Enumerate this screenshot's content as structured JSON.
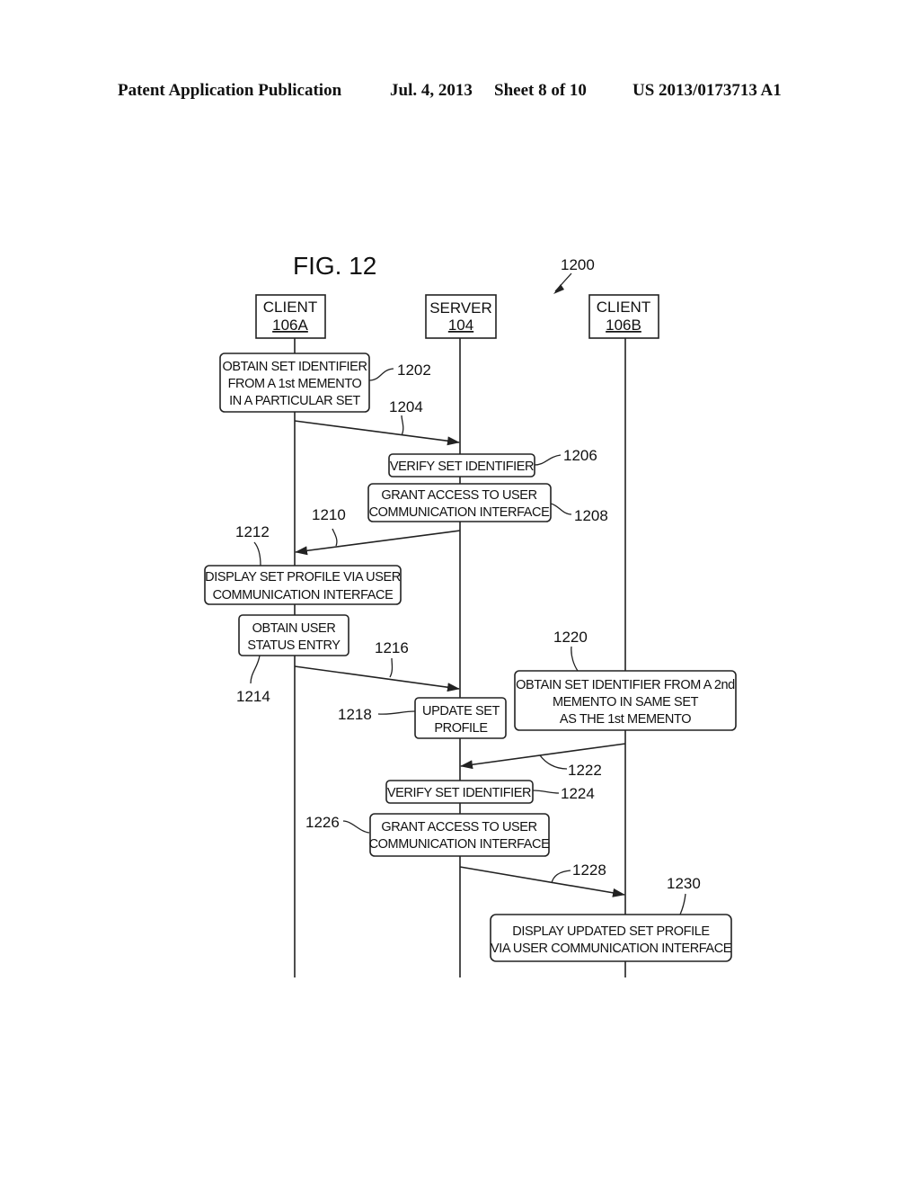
{
  "header": {
    "publication": "Patent Application Publication",
    "date": "Jul. 4, 2013",
    "sheet": "Sheet 8 of 10",
    "number": "US 2013/0173713 A1"
  },
  "figure": {
    "title": "FIG. 12",
    "ref": "1200"
  },
  "entities": [
    {
      "name": "CLIENT",
      "id": "106A"
    },
    {
      "name": "SERVER",
      "id": "104"
    },
    {
      "name": "CLIENT",
      "id": "106B"
    }
  ],
  "steps": {
    "s1202": {
      "ref": "1202",
      "lines": [
        "OBTAIN SET IDENTIFIER",
        "FROM A 1st MEMENTO",
        "IN A PARTICULAR SET"
      ]
    },
    "s1204": {
      "ref": "1204"
    },
    "s1206": {
      "ref": "1206",
      "lines": [
        "VERIFY SET IDENTIFIER"
      ]
    },
    "s1208": {
      "ref": "1208",
      "lines": [
        "GRANT ACCESS TO USER",
        "COMMUNICATION INTERFACE"
      ]
    },
    "s1210": {
      "ref": "1210"
    },
    "s1212": {
      "ref": "1212",
      "lines": [
        "DISPLAY SET PROFILE VIA USER",
        "COMMUNICATION INTERFACE"
      ]
    },
    "s1214": {
      "ref": "1214",
      "lines": [
        "OBTAIN USER",
        "STATUS ENTRY"
      ]
    },
    "s1216": {
      "ref": "1216"
    },
    "s1218": {
      "ref": "1218",
      "lines": [
        "UPDATE SET",
        "PROFILE"
      ]
    },
    "s1220": {
      "ref": "1220",
      "lines": [
        "OBTAIN SET IDENTIFIER FROM A 2nd",
        "MEMENTO IN SAME SET",
        "AS THE 1st MEMENTO"
      ]
    },
    "s1222": {
      "ref": "1222"
    },
    "s1224": {
      "ref": "1224",
      "lines": [
        "VERIFY SET IDENTIFIER"
      ]
    },
    "s1226": {
      "ref": "1226",
      "lines": [
        "GRANT ACCESS TO USER",
        "COMMUNICATION INTERFACE"
      ]
    },
    "s1228": {
      "ref": "1228"
    },
    "s1230": {
      "ref": "1230",
      "lines": [
        "DISPLAY UPDATED SET PROFILE",
        "VIA USER COMMUNICATION INTERFACE"
      ]
    }
  }
}
